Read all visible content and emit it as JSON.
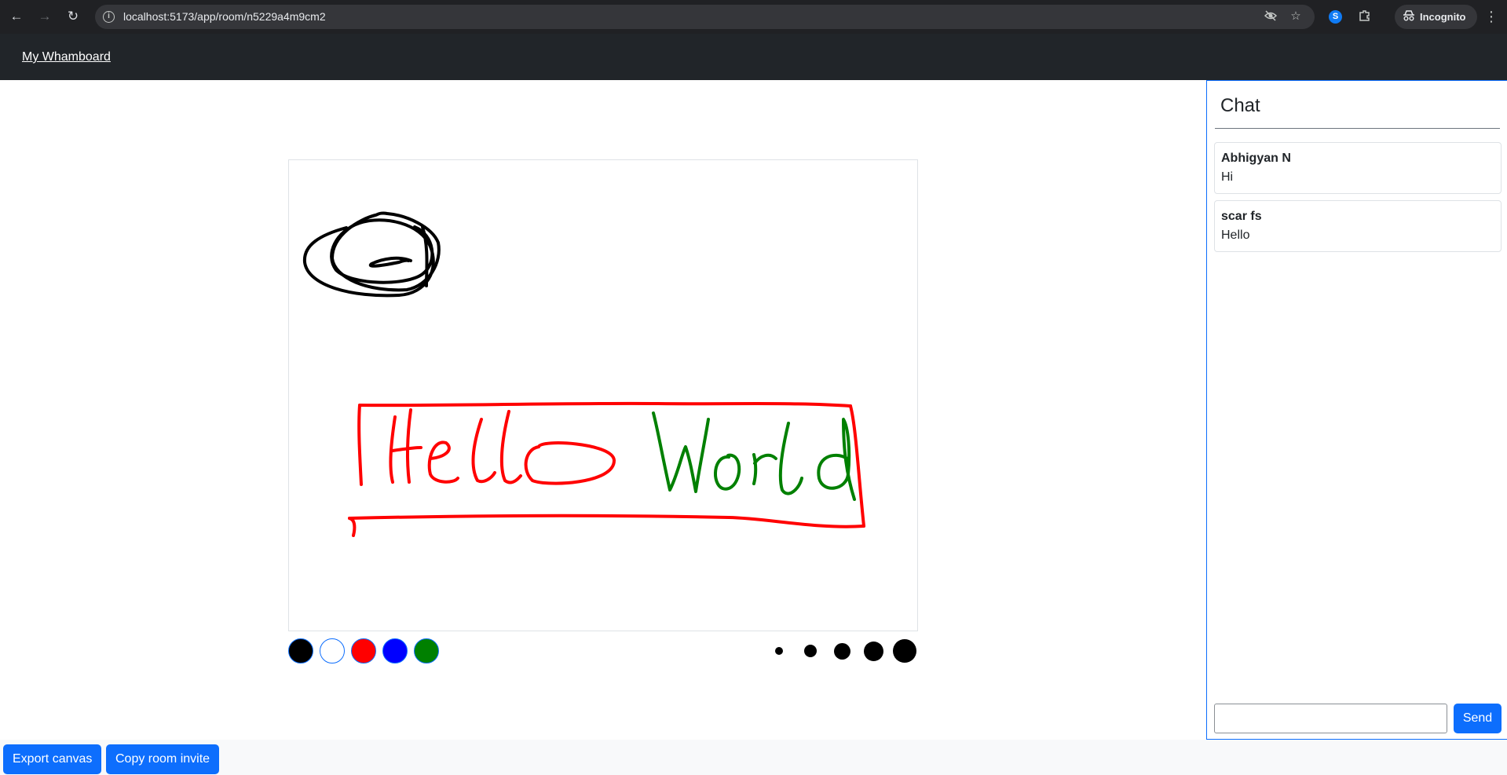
{
  "browser": {
    "url": "localhost:5173/app/room/n5229a4m9cm2",
    "profile_label": "Incognito",
    "icons": [
      "back-icon",
      "forward-icon",
      "reload-icon",
      "site-info-icon",
      "eye-off-icon",
      "star-icon",
      "shazam-icon",
      "extensions-icon",
      "incognito-icon",
      "menu-icon"
    ]
  },
  "navbar": {
    "brand": "My Whamboard"
  },
  "canvas": {
    "palette": [
      {
        "name": "black",
        "hex": "#000000"
      },
      {
        "name": "white",
        "hex": "#ffffff"
      },
      {
        "name": "red",
        "hex": "#ff0000"
      },
      {
        "name": "blue",
        "hex": "#0000ff"
      },
      {
        "name": "green",
        "hex": "#008000"
      }
    ],
    "brush_size_count": 5
  },
  "chat": {
    "title": "Chat",
    "messages": [
      {
        "author": "Abhigyan N",
        "text": "Hi"
      },
      {
        "author": "scar fs",
        "text": "Hello"
      }
    ],
    "input_value": "",
    "send_label": "Send"
  },
  "footer": {
    "export_label": "Export canvas",
    "invite_label": "Copy room invite"
  }
}
